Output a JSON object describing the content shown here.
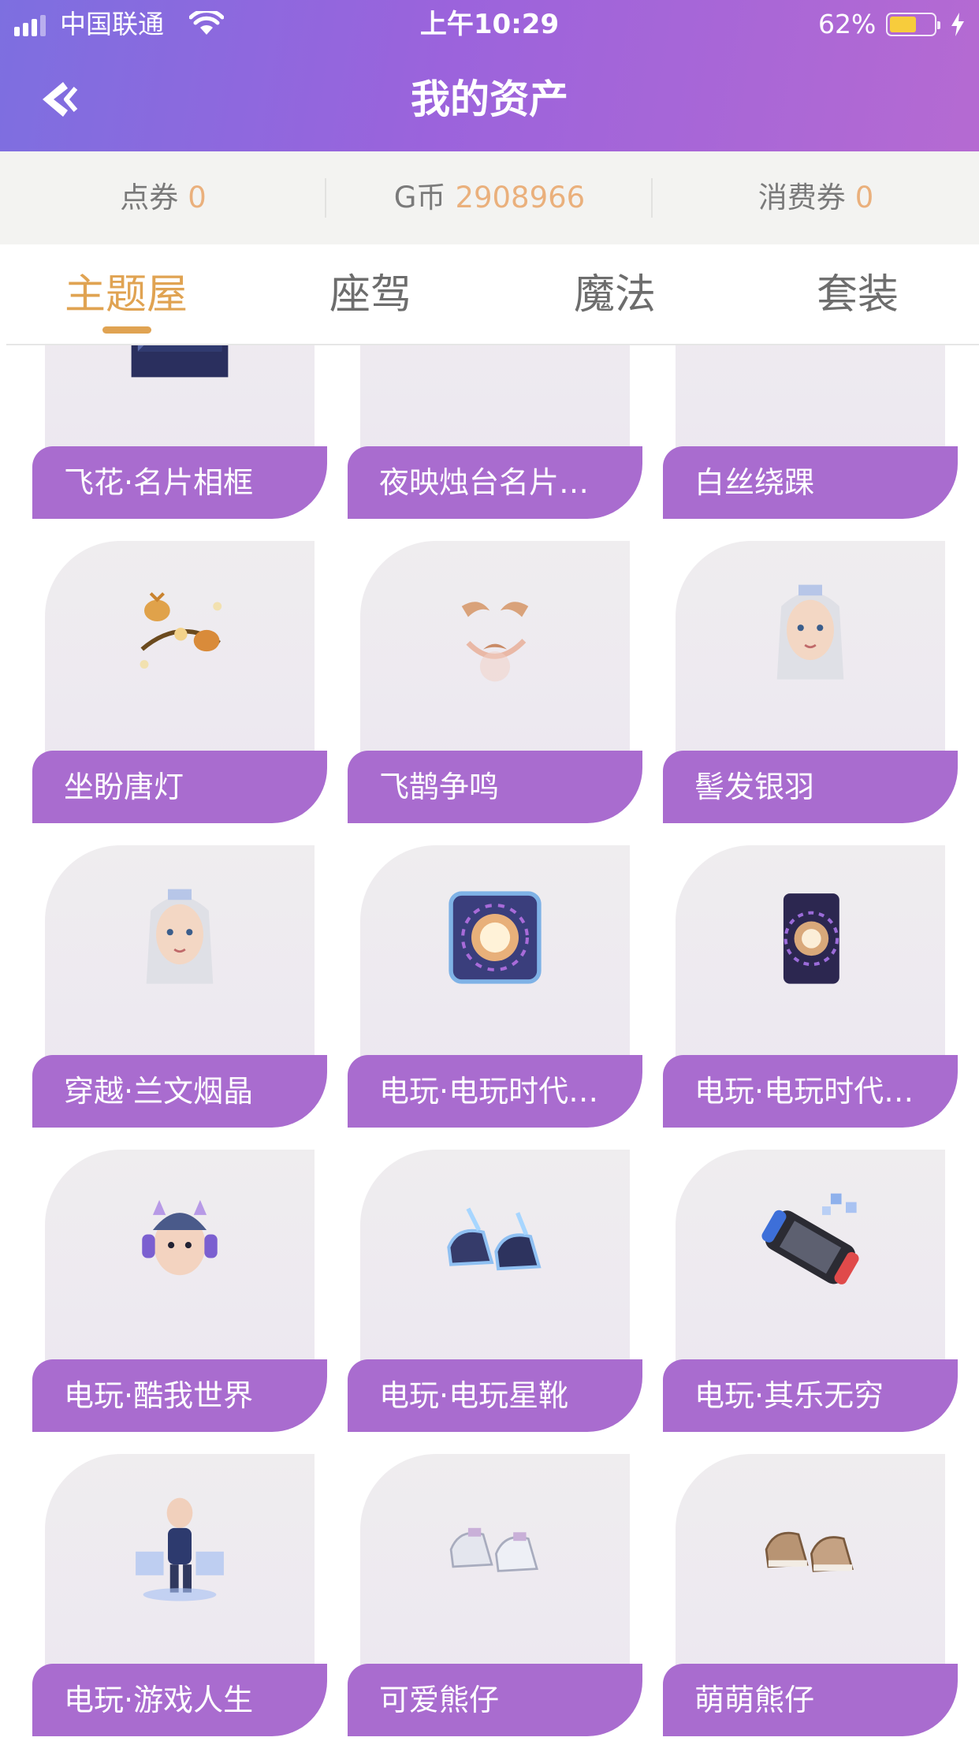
{
  "status_bar": {
    "carrier": "中国联通",
    "time": "上午10:29",
    "battery_pct": "62%",
    "battery_level": 0.62
  },
  "nav": {
    "title": "我的资产"
  },
  "balances": [
    {
      "label": "点券",
      "value": "0"
    },
    {
      "label": "G币",
      "value": "2908966"
    },
    {
      "label": "消费券",
      "value": "0"
    }
  ],
  "tabs": [
    {
      "label": "主题屋",
      "active": true
    },
    {
      "label": "座驾",
      "active": false
    },
    {
      "label": "魔法",
      "active": false
    },
    {
      "label": "套装",
      "active": false
    }
  ],
  "items": [
    {
      "name": "飞花·名片相框",
      "icon": "photo-frame-icon"
    },
    {
      "name": "夜映烛台名片…",
      "icon": "candle-card-icon"
    },
    {
      "name": "白丝绕踝",
      "icon": "white-shoes-icon"
    },
    {
      "name": "坐盼唐灯",
      "icon": "lantern-icon"
    },
    {
      "name": "飞鹊争鸣",
      "icon": "magpie-icon"
    },
    {
      "name": "髻发银羽",
      "icon": "silver-hair-head-icon"
    },
    {
      "name": "穿越·兰文烟晶",
      "icon": "silver-hair-head-icon"
    },
    {
      "name": "电玩·电玩时代…",
      "icon": "neon-frame-icon"
    },
    {
      "name": "电玩·电玩时代…",
      "icon": "neon-card-icon"
    },
    {
      "name": "电玩·酷我世界",
      "icon": "headphone-head-icon"
    },
    {
      "name": "电玩·电玩星靴",
      "icon": "sneakers-icon"
    },
    {
      "name": "电玩·其乐无穷",
      "icon": "handheld-console-icon"
    },
    {
      "name": "电玩·游戏人生",
      "icon": "gamer-avatar-icon"
    },
    {
      "name": "可爱熊仔",
      "icon": "white-sneakers-icon"
    },
    {
      "name": "萌萌熊仔",
      "icon": "brown-sneakers-icon"
    }
  ]
}
